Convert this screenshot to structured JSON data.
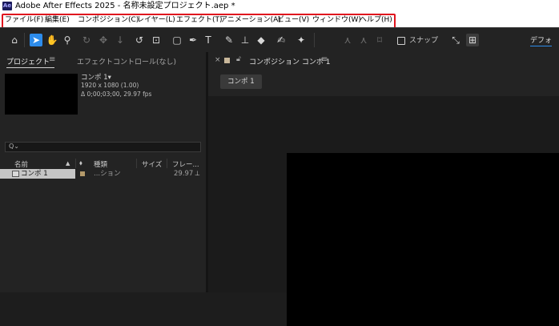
{
  "window": {
    "app_icon": "Ae",
    "title": "Adobe After Effects 2025 - 名称未設定プロジェクト.aep *"
  },
  "menu": [
    "ファイル(F)",
    "編集(E)",
    "コンポジション(C)",
    "レイヤー(L)",
    "エフェクト(T)",
    "アニメーション(A)",
    "ビュー(V)",
    "ウィンドウ(W)",
    "ヘルプ(H)"
  ],
  "toolbar": {
    "tools": [
      "home-icon",
      "selection-tool-icon",
      "hand-tool-icon",
      "zoom-tool-icon",
      "orbit-camera-icon",
      "pan-camera-icon",
      "dolly-camera-icon",
      "rotation-tool-icon",
      "pan-behind-icon",
      "rectangle-tool-icon",
      "pen-tool-icon",
      "type-tool-icon",
      "brush-tool-icon",
      "clone-stamp-icon",
      "eraser-tool-icon",
      "roto-brush-icon",
      "puppet-pin-icon"
    ],
    "snap_label": "スナップ",
    "workspace_label": "デフォ"
  },
  "project_panel": {
    "tab_label": "プロジェクト",
    "menu_glyph": "≡",
    "effects_tab": "エフェクトコントロール(なし)",
    "comp_name": "コンポ 1▾",
    "comp_res": "1920 x 1080 (1.00)",
    "comp_duration": "Δ 0;00;03;00, 29.97 fps",
    "search_placeholder": "",
    "columns": {
      "name": "名前",
      "type": "種類",
      "size": "サイズ",
      "frame": "フレー..."
    },
    "items": [
      {
        "name": "コンポ 1",
        "type": "...ション",
        "fps": "29.97",
        "label_color": "#b49a6a"
      }
    ]
  },
  "comp_panel": {
    "close_glyph": "×",
    "tab_label": "コンポジション コンポ 1",
    "menu_glyph": "≡",
    "breadcrumb": "コンポ 1"
  },
  "colors": {
    "accent": "#2d8ceb",
    "highlight_box": "#e0141e",
    "panel_bg": "#232323"
  }
}
